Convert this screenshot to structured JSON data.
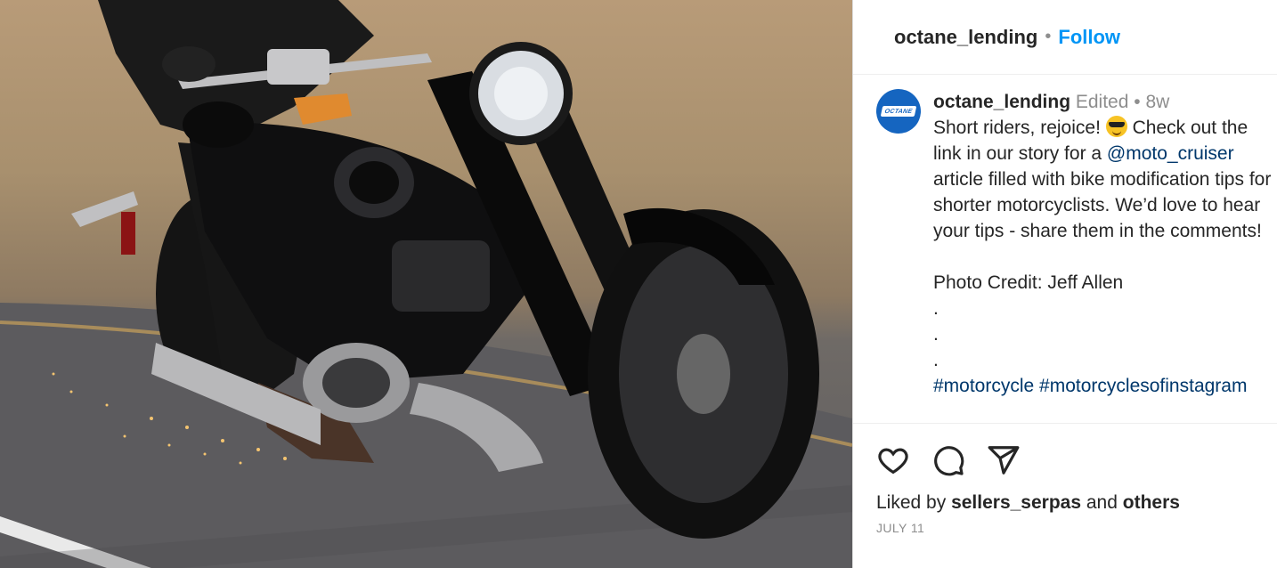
{
  "post": {
    "image_alt": "Rider leaning a black motorcycle into a turn with sparks from the footpeg"
  },
  "header": {
    "username": "octane_lending",
    "separator": "•",
    "follow_label": "Follow"
  },
  "caption": {
    "avatar_logo": "OCTANE",
    "username": "octane_lending",
    "edited": "Edited",
    "separator": "•",
    "age": "8w",
    "text_1": "Short riders, rejoice! ",
    "emoji": "smiling-face-with-sunglasses",
    "text_2": " Check out the link in our story for a ",
    "mention": "@moto_cruiser",
    "text_3": " article filled with bike modification tips for shorter motorcyclists. We’d love to hear your tips - share them in the comments!\n\nPhoto Credit: Jeff Allen\n.\n.\n.\n",
    "hashtag_1": "#motorcycle",
    "hashtag_2": "#motorcyclesofinstagram"
  },
  "actions": {
    "like_icon": "heart-icon",
    "comment_icon": "comment-icon",
    "share_icon": "paper-plane-icon"
  },
  "likes": {
    "prefix": "Liked by ",
    "user": "sellers_serpas",
    "middle": " and ",
    "others": "others"
  },
  "date": "JULY 11",
  "colors": {
    "accent": "#0095f6",
    "link": "#00376b",
    "avatar_bg": "#1565c0",
    "muted": "#8e8e8e"
  }
}
